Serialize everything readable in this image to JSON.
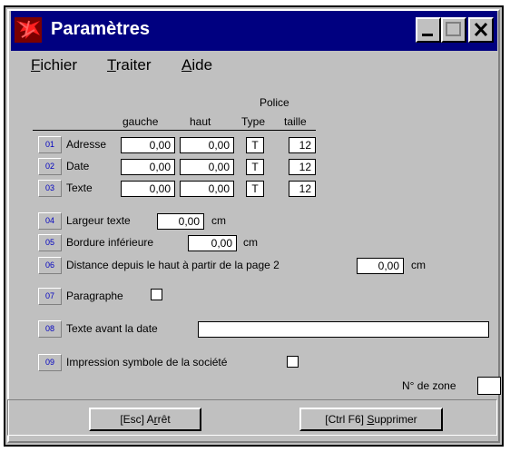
{
  "window": {
    "title": "Paramètres"
  },
  "menu": [
    {
      "hotkey": "F",
      "rest": "ichier"
    },
    {
      "hotkey": "T",
      "rest": "raiter"
    },
    {
      "hotkey": "A",
      "rest": "ide"
    }
  ],
  "headers": {
    "police": "Police",
    "gauche": "gauche",
    "haut": "haut",
    "type": "Type",
    "taille": "taille"
  },
  "rows": [
    {
      "num": "01",
      "label": "Adresse",
      "gauche": "0,00",
      "haut": "0,00",
      "type": "T",
      "taille": "12"
    },
    {
      "num": "02",
      "label": "Date",
      "gauche": "0,00",
      "haut": "0,00",
      "type": "T",
      "taille": "12"
    },
    {
      "num": "03",
      "label": "Texte",
      "gauche": "0,00",
      "haut": "0,00",
      "type": "T",
      "taille": "12"
    }
  ],
  "settings": {
    "largeur": {
      "num": "04",
      "label": "Largeur texte",
      "value": "0,00",
      "unit": "cm"
    },
    "bordure": {
      "num": "05",
      "label": "Bordure inférieure",
      "value": "0,00",
      "unit": "cm"
    },
    "distance": {
      "num": "06",
      "label": "Distance depuis le haut à partir de la page 2",
      "value": "0,00",
      "unit": "cm"
    },
    "paragraphe": {
      "num": "07",
      "label": "Paragraphe",
      "checked": false
    },
    "texte_avant": {
      "num": "08",
      "label": "Texte avant la date",
      "value": ""
    },
    "impression": {
      "num": "09",
      "label": "Impression symbole de la société",
      "checked": false
    },
    "zone": {
      "label": "N° de zone",
      "value": ""
    }
  },
  "buttons": {
    "stop_pre": "[Esc] A",
    "stop_hot": "r",
    "stop_post": "rêt",
    "delete_pre": "[Ctrl F6] ",
    "delete_hot": "S",
    "delete_post": "upprimer"
  }
}
